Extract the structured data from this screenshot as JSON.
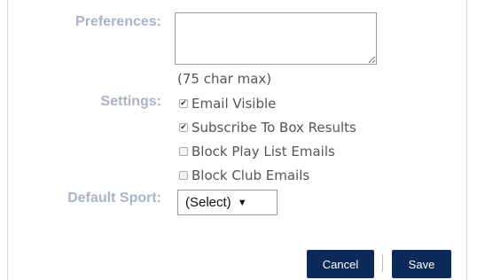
{
  "form": {
    "preferences": {
      "label": "Preferences:",
      "value": "",
      "hint": "(75 char max)"
    },
    "settings": {
      "label": "Settings:",
      "options": [
        {
          "label": "Email Visible",
          "checked": true
        },
        {
          "label": "Subscribe To Box Results",
          "checked": true
        },
        {
          "label": "Block Play List Emails",
          "checked": false
        },
        {
          "label": "Block Club Emails",
          "checked": false
        }
      ]
    },
    "default_sport": {
      "label": "Default Sport:",
      "selected": "(Select)"
    }
  },
  "buttons": {
    "cancel": "Cancel",
    "save": "Save"
  },
  "colors": {
    "label": "#a8b3c9",
    "button": "#0c2a5a"
  },
  "icons": {
    "checkmark": "✔",
    "dropdown_arrow": "▼"
  }
}
